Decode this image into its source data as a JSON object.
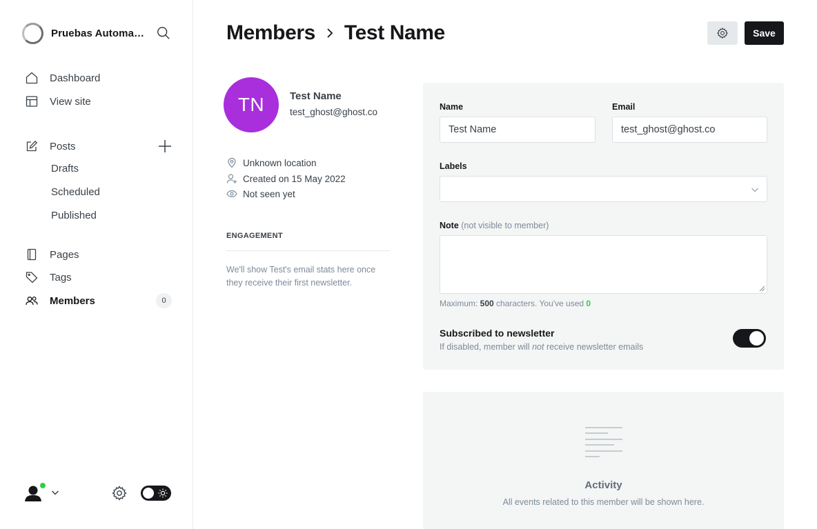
{
  "sidebar": {
    "site_name": "Pruebas Automatizadas",
    "nav": {
      "dashboard": "Dashboard",
      "view_site": "View site",
      "posts": "Posts",
      "drafts": "Drafts",
      "scheduled": "Scheduled",
      "published": "Published",
      "pages": "Pages",
      "tags": "Tags",
      "members": "Members",
      "members_count": "0"
    },
    "icons": [
      "search-icon",
      "home-icon",
      "layout-icon",
      "edit-icon",
      "plus-icon",
      "page-icon",
      "tag-icon",
      "members-icon",
      "user-avatar-icon",
      "chevron-down-icon",
      "gear-icon",
      "sun-icon"
    ],
    "online_dot_color": "#30cf43"
  },
  "header": {
    "breadcrumb_parent": "Members",
    "breadcrumb_current": "Test Name",
    "save_label": "Save"
  },
  "member": {
    "initials": "TN",
    "avatar_color": "#a82fdb",
    "name": "Test Name",
    "email": "test_ghost@ghost.co",
    "location": "Unknown location",
    "created": "Created on 15 May 2022",
    "last_seen": "Not seen yet",
    "engagement_title": "ENGAGEMENT",
    "engagement_text": "We'll show Test's email stats here once they receive their first newsletter."
  },
  "form": {
    "name_label": "Name",
    "name_value": "Test Name",
    "email_label": "Email",
    "email_value": "test_ghost@ghost.co",
    "labels_label": "Labels",
    "note_label": "Note",
    "note_hint": "(not visible to member)",
    "counter_prefix": "Maximum: ",
    "counter_max": "500",
    "counter_mid": " characters. You've used ",
    "counter_used": "0",
    "newsletter_title": "Subscribed to newsletter",
    "newsletter_help_1": "If disabled, member will ",
    "newsletter_help_em": "not",
    "newsletter_help_2": " receive newsletter emails",
    "newsletter_subscribed": true
  },
  "activity": {
    "title": "Activity",
    "description": "All events related to this member will be shown here."
  }
}
